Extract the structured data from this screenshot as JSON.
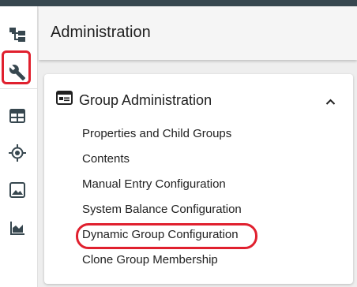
{
  "header": {
    "title": "Administration"
  },
  "sidebar": {
    "items": [
      {
        "icon": "hierarchy-icon",
        "label": ""
      },
      {
        "icon": "wrench-icon",
        "label": ""
      },
      {
        "icon": "table-icon",
        "label": ""
      },
      {
        "icon": "target-icon",
        "label": ""
      },
      {
        "icon": "image-icon",
        "label": ""
      },
      {
        "icon": "area-chart-icon",
        "label": ""
      }
    ]
  },
  "panel": {
    "title": "Group Administration",
    "icon": "admin-window-icon",
    "collapse_icon": "chevron-up-icon",
    "items": [
      {
        "label": "Properties and Child Groups"
      },
      {
        "label": "Contents"
      },
      {
        "label": "Manual Entry Configuration"
      },
      {
        "label": "System Balance Configuration"
      },
      {
        "label": "Dynamic Group Configuration"
      },
      {
        "label": "Clone Group Membership"
      }
    ]
  },
  "colors": {
    "topbar": "#37474f",
    "sidebar_icon": "#37474f",
    "highlight": "#e0202e",
    "text": "#212121"
  }
}
